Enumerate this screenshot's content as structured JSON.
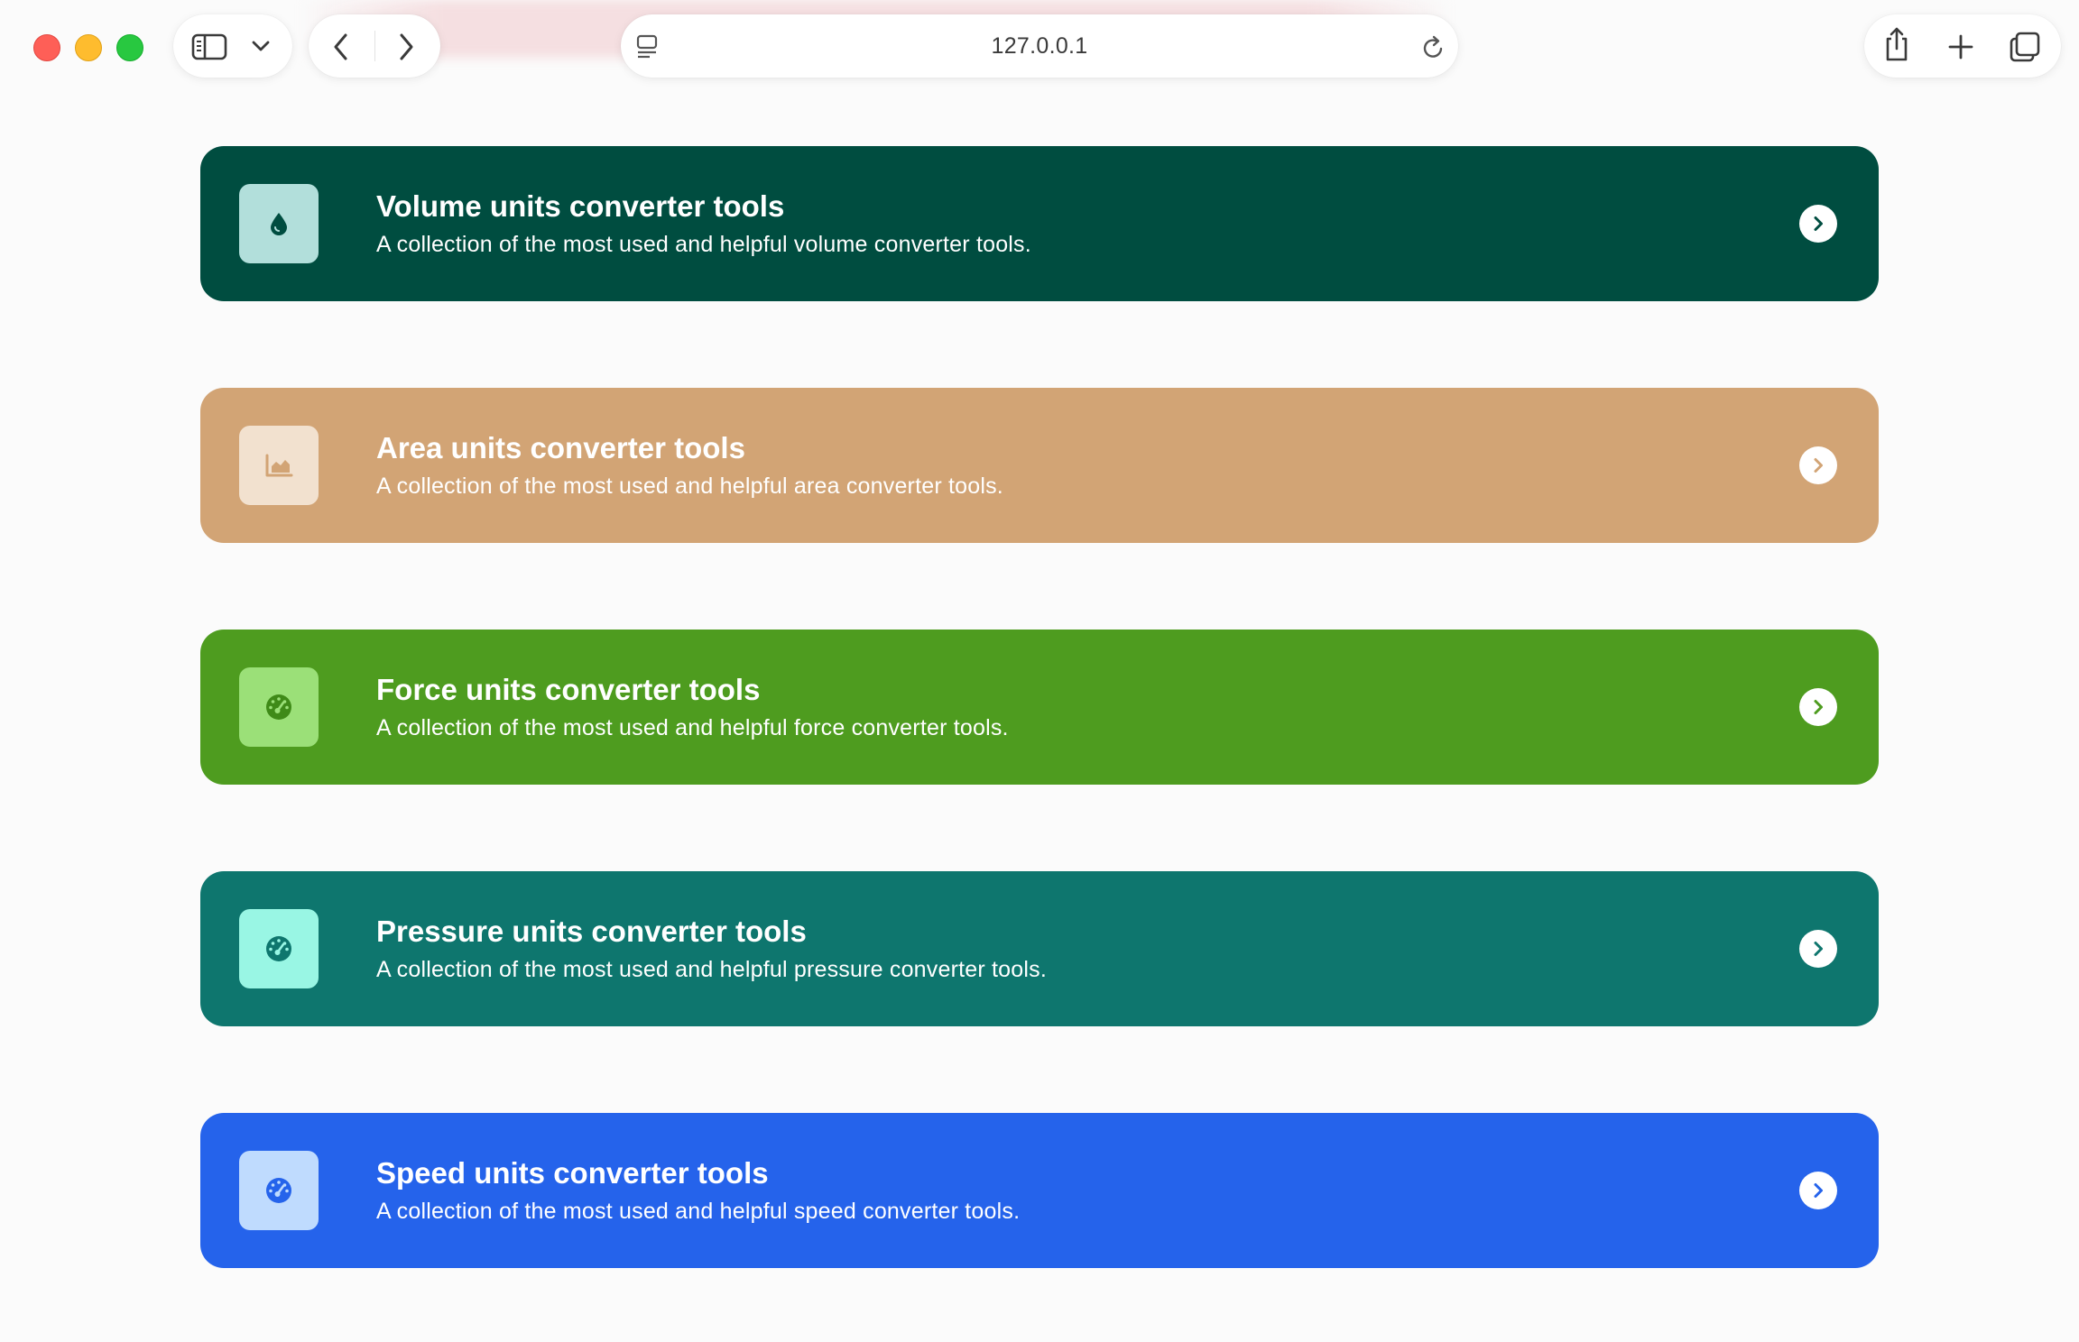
{
  "browser": {
    "address": "127.0.0.1",
    "icons": {
      "sidebar": "sidebar-icon",
      "tab_overview_menu": "chevron-down-icon",
      "back": "chevron-left-icon",
      "forward": "chevron-right-icon",
      "page_settings": "page-settings-icon",
      "reload": "reload-icon",
      "share": "share-icon",
      "new_tab": "plus-icon",
      "tabs": "tabs-overview-icon"
    },
    "traffic_light_colors": {
      "close": "#fe5f57",
      "minimize": "#febc2e",
      "maximize": "#28c840"
    }
  },
  "cards": [
    {
      "title": "Volume units converter tools",
      "description": "A collection of the most used and helpful volume converter tools.",
      "icon": "droplet-icon",
      "bg_color": "#004d40",
      "icon_bg_color": "#b2dfdb",
      "icon_color": "#004d40"
    },
    {
      "title": "Area units converter tools",
      "description": "A collection of the most used and helpful area converter tools.",
      "icon": "area-chart-icon",
      "bg_color": "#d2a475",
      "icon_bg_color": "#f2e1cf",
      "icon_color": "#d2a475"
    },
    {
      "title": "Force units converter tools",
      "description": "A collection of the most used and helpful force converter tools.",
      "icon": "gauge-icon",
      "bg_color": "#4e9c1f",
      "icon_bg_color": "#9be078",
      "icon_color": "#3f8a18"
    },
    {
      "title": "Pressure units converter tools",
      "description": "A collection of the most used and helpful pressure converter tools.",
      "icon": "gauge-icon",
      "bg_color": "#0e766e",
      "icon_bg_color": "#99f6e4",
      "icon_color": "#0e766e"
    },
    {
      "title": "Speed units converter tools",
      "description": "A collection of the most used and helpful speed converter tools.",
      "icon": "gauge-icon",
      "bg_color": "#2563eb",
      "icon_bg_color": "#bfdbfe",
      "icon_color": "#2563eb"
    }
  ]
}
